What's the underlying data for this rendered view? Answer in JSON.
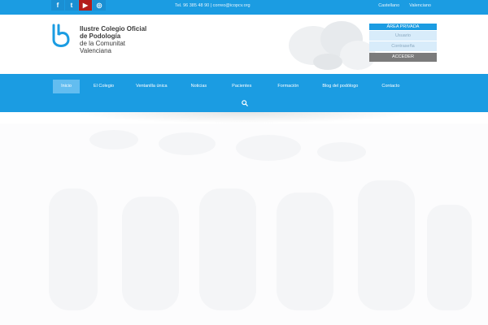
{
  "topbar": {
    "social": [
      {
        "icon": "facebook-icon",
        "glyph": "f"
      },
      {
        "icon": "twitter-icon",
        "glyph": "t"
      },
      {
        "icon": "youtube-icon",
        "glyph": "▶"
      },
      {
        "icon": "instagram-icon",
        "glyph": "◎"
      }
    ],
    "contact": "Tel. 96 385 48 90  |  correo@icopcv.org",
    "languages": [
      "Castellano",
      "Valenciano"
    ]
  },
  "logo": {
    "line1": "Ilustre Colegio Oficial",
    "line2": "de Podología",
    "line3": "de la Comunitat",
    "line4": "Valenciana"
  },
  "login": {
    "title": "ÁREA PRIVADA",
    "user_placeholder": "Usuario",
    "password_placeholder": "Contraseña",
    "submit": "ACCEDER"
  },
  "nav": {
    "items": [
      "Inicio",
      "El Colegio",
      "Ventanilla única",
      "Noticias",
      "Pacientes",
      "Formación",
      "Blog del podólogo",
      "Contacto"
    ],
    "active": "Inicio"
  },
  "colors": {
    "brand_blue": "#1b9ce2",
    "active_tab": "#63bdf0",
    "button_gray": "#7b7b7b"
  }
}
